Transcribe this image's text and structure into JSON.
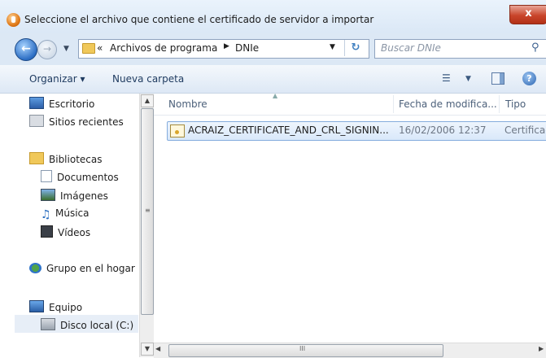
{
  "window": {
    "title": "Seleccione el archivo que contiene el certificado de servidor a importar",
    "close_label": "x"
  },
  "address": {
    "chevron": "«",
    "crumbs": [
      "Archivos de programa",
      "DNIe"
    ]
  },
  "search": {
    "placeholder": "Buscar DNIe"
  },
  "toolbar": {
    "organize": "Organizar ▾",
    "new_folder": "Nueva carpeta"
  },
  "nav": {
    "items": [
      {
        "label": "Escritorio",
        "icon": "desktop-icon"
      },
      {
        "label": "Sitios recientes",
        "icon": "recent-places-icon"
      },
      {
        "label": "Bibliotecas",
        "icon": "libraries-icon"
      },
      {
        "label": "Documentos",
        "icon": "documents-icon"
      },
      {
        "label": "Imágenes",
        "icon": "pictures-icon"
      },
      {
        "label": "Música",
        "icon": "music-icon"
      },
      {
        "label": "Vídeos",
        "icon": "videos-icon"
      },
      {
        "label": "Grupo en el hogar",
        "icon": "homegroup-icon"
      },
      {
        "label": "Equipo",
        "icon": "computer-icon"
      },
      {
        "label": "Disco local (C:)",
        "icon": "local-disk-icon"
      }
    ],
    "selected": "Disco local (C:)"
  },
  "columns": {
    "name": "Nombre",
    "date": "Fecha de modifica...",
    "type": "Tipo"
  },
  "files": [
    {
      "name": "ACRAIZ_CERTIFICATE_AND_CRL_SIGNIN...",
      "date": "16/02/2006 12:37",
      "type": "Certificado"
    }
  ],
  "scrollbar": {
    "grip": "III"
  }
}
